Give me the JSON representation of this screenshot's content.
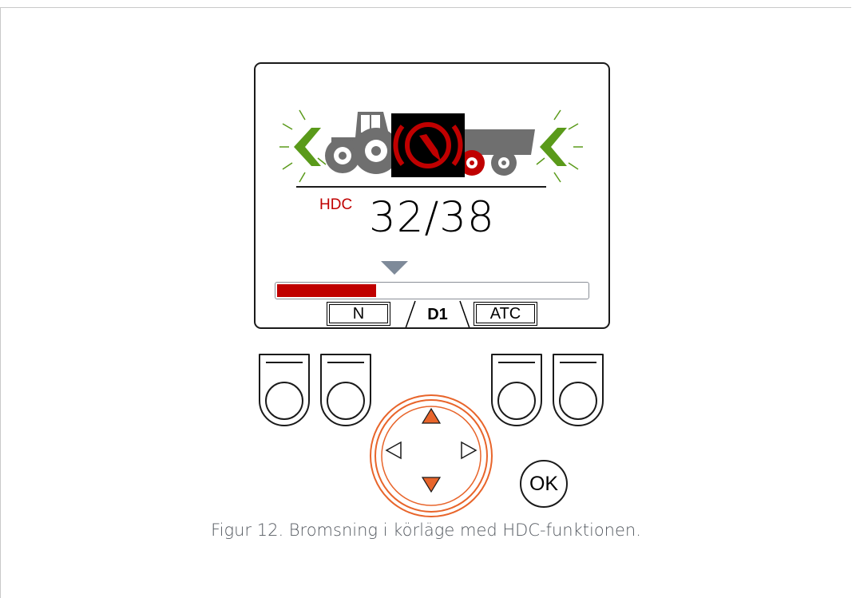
{
  "display": {
    "hdc_label": "HDC",
    "speed_readout": "32/38",
    "bar_level": 0.32,
    "tabs": {
      "left": "N",
      "center": "D1",
      "right": "ATC"
    },
    "colors": {
      "brake_red": "#c00000",
      "arrow_green": "#5a9a1a",
      "tractor_gray": "#6f6f6f",
      "pointer_gray": "#7e8a99",
      "dpad_orange": "#e8652b"
    }
  },
  "controls": {
    "ok_label": "OK",
    "dpad_icons": [
      "arrow-up-icon",
      "arrow-down-icon",
      "arrow-left-icon",
      "arrow-right-icon"
    ]
  },
  "caption": "Figur 12. Bromsning i körläge med HDC-funktionen."
}
